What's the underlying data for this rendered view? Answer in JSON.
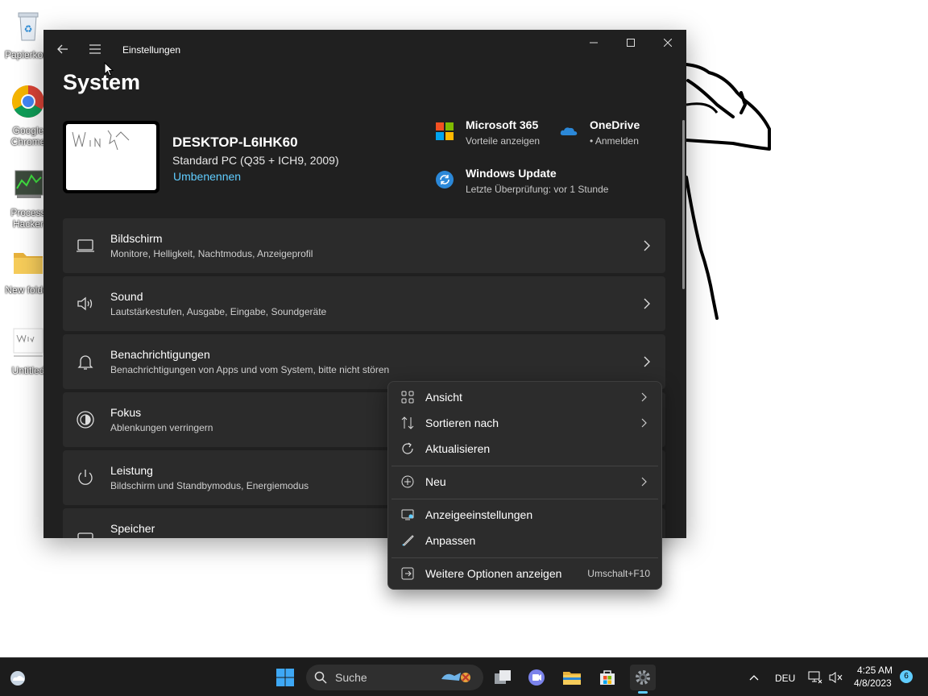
{
  "desktop": {
    "icons": [
      {
        "label": "Papierkorb",
        "icon": "recycle-bin-icon"
      },
      {
        "label": "Google Chrome",
        "icon": "chrome-icon"
      },
      {
        "label": "Process Hacker",
        "icon": "process-hacker-icon"
      },
      {
        "label": "New folder",
        "icon": "folder-icon"
      },
      {
        "label": "Untitled",
        "icon": "image-file-icon"
      }
    ]
  },
  "window": {
    "title": "Einstellungen",
    "page_title": "System",
    "device": {
      "name": "DESKTOP-L6IHK60",
      "model": "Standard PC (Q35 + ICH9, 2009)",
      "rename": "Umbenennen"
    },
    "quick": [
      {
        "title": "Microsoft 365",
        "sub": "Vorteile anzeigen",
        "icon": "microsoft-365-icon"
      },
      {
        "title": "OneDrive",
        "sub": "• Anmelden",
        "icon": "onedrive-icon"
      },
      {
        "title": "Windows Update",
        "sub": "Letzte Überprüfung: vor 1 Stunde",
        "icon": "windows-update-icon"
      }
    ],
    "cards": [
      {
        "title": "Bildschirm",
        "sub": "Monitore, Helligkeit, Nachtmodus, Anzeigeprofil",
        "icon": "display-icon"
      },
      {
        "title": "Sound",
        "sub": "Lautstärkestufen, Ausgabe, Eingabe, Soundgeräte",
        "icon": "speaker-icon"
      },
      {
        "title": "Benachrichtigungen",
        "sub": "Benachrichtigungen von Apps und vom System, bitte nicht stören",
        "icon": "bell-icon"
      },
      {
        "title": "Fokus",
        "sub": "Ablenkungen verringern",
        "icon": "focus-icon"
      },
      {
        "title": "Leistung",
        "sub": "Bildschirm und Standbymodus, Energiemodus",
        "icon": "power-icon"
      },
      {
        "title": "Speicher",
        "sub": "",
        "icon": "storage-icon"
      }
    ]
  },
  "context_menu": {
    "items": [
      {
        "label": "Ansicht",
        "icon": "grid-view-icon",
        "submenu": true
      },
      {
        "label": "Sortieren nach",
        "icon": "sort-icon",
        "submenu": true
      },
      {
        "label": "Aktualisieren",
        "icon": "refresh-icon",
        "submenu": false
      },
      {
        "label": "Neu",
        "icon": "plus-circle-icon",
        "submenu": true
      },
      {
        "label": "Anzeigeeinstellungen",
        "icon": "display-settings-icon",
        "submenu": false
      },
      {
        "label": "Anpassen",
        "icon": "brush-icon",
        "submenu": false
      },
      {
        "label": "Weitere Optionen anzeigen",
        "icon": "more-options-icon",
        "shortcut": "Umschalt+F10"
      }
    ]
  },
  "taskbar": {
    "search_placeholder": "Suche",
    "language": "DEU",
    "time": "4:25 AM",
    "date": "4/8/2023",
    "notification_count": "6"
  },
  "colors": {
    "accent": "#60cdff",
    "window_bg": "#202020",
    "card_bg": "#2b2b2b",
    "menu_bg": "#2c2c2c",
    "taskbar_bg": "#1c1c1c"
  }
}
